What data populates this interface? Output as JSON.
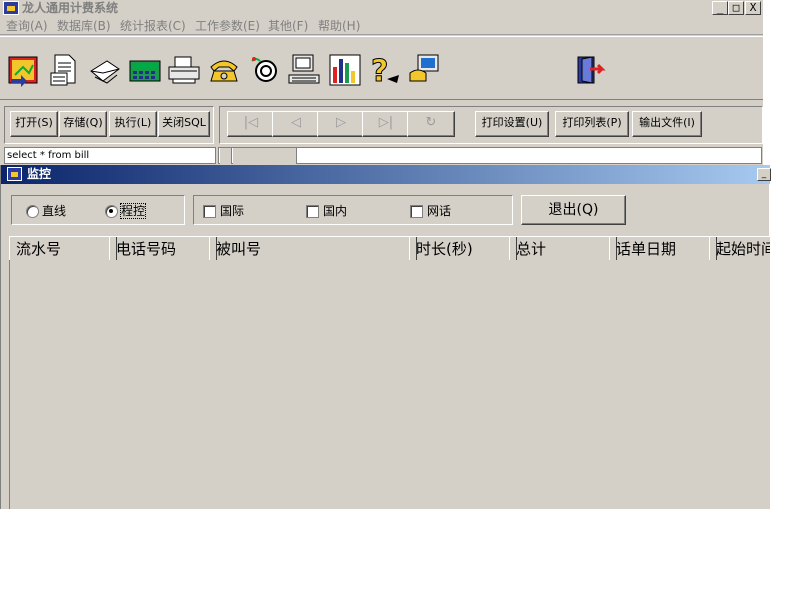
{
  "app": {
    "title": "龙人通用计费系统"
  },
  "window_controls": {
    "minimize": "_",
    "maximize": "□",
    "close": "X"
  },
  "menu": [
    "查询(A)",
    "数据库(B)",
    "统计报表(C)",
    "工作参数(E)",
    "其他(F)",
    "帮助(H)"
  ],
  "toolbar_icons": [
    "query-icon",
    "document-icon",
    "envelope-icon",
    "calculator-icon",
    "printer-icon",
    "telephone-icon",
    "speaker-icon",
    "computer-icon",
    "bar-chart-icon",
    "help-icon",
    "network-computer-icon",
    "exit-door-icon"
  ],
  "sql_toolbar": {
    "open": "打开(S)",
    "save": "存储(Q)",
    "execute": "执行(L)",
    "close_sql": "关闭SQL",
    "nav": {
      "first": "|◁",
      "prev": "◁",
      "next": "▷",
      "last": "▷|",
      "refresh": "↻"
    },
    "print_setup": "打印设置(U)",
    "print_list": "打印列表(P)",
    "export_file": "输出文件(I)"
  },
  "sql_query": "select * from bill",
  "monitor": {
    "title": "监控",
    "min": "_",
    "modes": {
      "direct": "直线",
      "program": "程控",
      "selected": "program"
    },
    "filters": [
      {
        "label": "国际",
        "checked": false
      },
      {
        "label": "国内",
        "checked": false
      },
      {
        "label": "网话",
        "checked": false
      }
    ],
    "exit": "退出(Q)",
    "columns": [
      "流水号",
      "电话号码",
      "被叫号",
      "时长(秒)",
      "总计",
      "话单日期",
      "起始时间"
    ],
    "rows": []
  },
  "colors": {
    "face": "#d4d0c8",
    "title_start": "#0a246a",
    "title_end": "#a6caf0"
  }
}
